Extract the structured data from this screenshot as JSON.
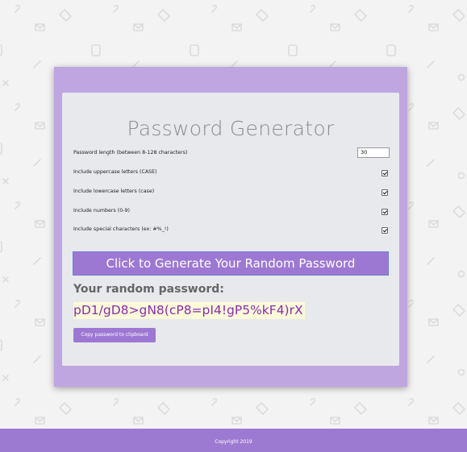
{
  "app": {
    "title": "Password Generator"
  },
  "options": {
    "length_label": "Password length (between 8-128 characters)",
    "length_value": "30",
    "uppercase_label": "Include uppercase letters (CASE)",
    "uppercase_checked": true,
    "lowercase_label": "Include lowercase letters (case)",
    "lowercase_checked": true,
    "numbers_label": "Include numbers (0-9)",
    "numbers_checked": true,
    "special_label": "Include special characters (ex: #%_!)",
    "special_checked": true
  },
  "actions": {
    "generate_label": "Click to Generate Your Random Password",
    "copy_label": "Copy password to clipboard"
  },
  "result": {
    "heading": "Your random password:",
    "password": "pD1/gD8>gN8(cP8=pI4!gP5%kF4)rX"
  },
  "footer": {
    "copyright": "Copyright 2019"
  },
  "colors": {
    "accent": "#9d78d3",
    "card_border": "#bfa6e0",
    "card_background": "#e8e9ec",
    "password_text": "#8b2bb0",
    "password_highlight": "#fcfad8"
  },
  "icons": {
    "background_pattern": [
      "tag-icon",
      "tablet-icon",
      "mail-icon",
      "pencil-icon",
      "paperclip-icon",
      "gear-icon"
    ]
  }
}
